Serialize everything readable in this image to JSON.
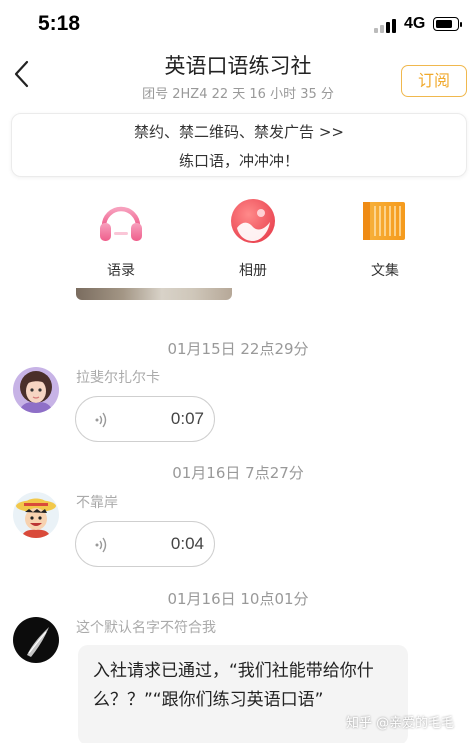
{
  "status_bar": {
    "time": "5:18",
    "network": "4G"
  },
  "header": {
    "title": "英语口语练习社",
    "subtitle": "团号 2HZ4  22 天 16 小时 35 分",
    "subscribe_label": "订阅"
  },
  "notice": {
    "line1": "禁约、禁二维码、禁发广告 >>",
    "line2": "练口语，冲冲冲！"
  },
  "toolbar": [
    {
      "label": "语录",
      "icon": "headphones-icon"
    },
    {
      "label": "相册",
      "icon": "album-icon"
    },
    {
      "label": "文集",
      "icon": "book-icon"
    }
  ],
  "messages": [
    {
      "time": "01月15日  22点29分",
      "sender": "拉斐尔扎尔卡",
      "type": "voice",
      "duration": "0:07"
    },
    {
      "time": "01月16日  7点27分",
      "sender": "不靠岸",
      "type": "voice",
      "duration": "0:04"
    },
    {
      "time": "01月16日  10点01分",
      "sender": "这个默认名字不符合我",
      "type": "text",
      "text": "入社请求已通过，“我们社能带给你什么？？”“跟你们练习英语口语”"
    }
  ],
  "watermark": "知乎 @亲爱的毛毛",
  "colors": {
    "accent": "#f0a92c",
    "headphones": "#f27aa0",
    "album": "#f25a5a",
    "book": "#f5a623",
    "muted_text": "#999999"
  }
}
